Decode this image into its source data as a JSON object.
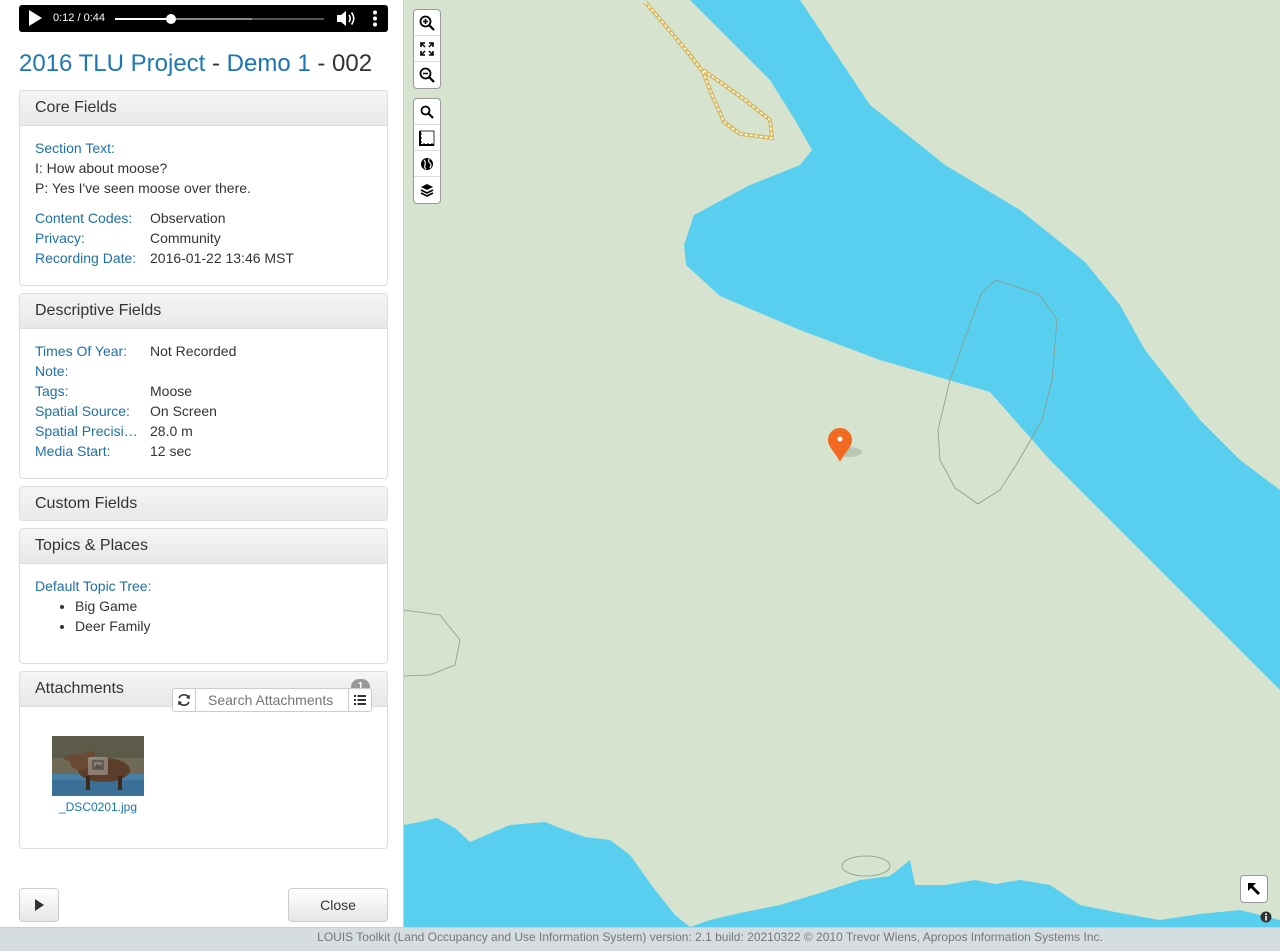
{
  "audio": {
    "time": "0:12 / 0:44",
    "progress": 0.27
  },
  "title": {
    "project": "2016 TLU Project",
    "sep1": " - ",
    "demo": "Demo 1",
    "sep2": " - ",
    "item": "002"
  },
  "core": {
    "heading": "Core Fields",
    "section_label": "Section Text:",
    "section_lines": [
      "I: How about moose?",
      "P: Yes I've seen moose over there."
    ],
    "rows": [
      {
        "label": "Content Codes:",
        "value": "Observation"
      },
      {
        "label": "Privacy:",
        "value": "Community"
      },
      {
        "label": "Recording Date:",
        "value": "2016-01-22 13:46 MST"
      }
    ]
  },
  "descriptive": {
    "heading": "Descriptive Fields",
    "rows": [
      {
        "label": "Times Of Year:",
        "value": "Not Recorded"
      },
      {
        "label": "Note:",
        "value": ""
      },
      {
        "label": "Tags:",
        "value": "Moose"
      },
      {
        "label": "Spatial Source:",
        "value": "On Screen"
      },
      {
        "label": "Spatial Precisi…",
        "value": "28.0 m"
      },
      {
        "label": "Media Start:",
        "value": "12 sec"
      }
    ]
  },
  "custom": {
    "heading": "Custom Fields"
  },
  "topics": {
    "heading": "Topics & Places",
    "tree_label": "Default Topic Tree:",
    "items": [
      "Big Game",
      "Deer Family"
    ]
  },
  "attachments": {
    "heading": "Attachments",
    "count": "1",
    "search_placeholder": "Search Attachments",
    "files": [
      "_DSC0201.jpg"
    ]
  },
  "buttons": {
    "close": "Close"
  },
  "footer": "LOUIS Toolkit (Land Occupancy and Use Information System) version: 2.1 build: 20210322 © 2010 Trevor Wiens, Apropos Information Systems Inc.",
  "colors": {
    "water": "#58cfee",
    "land": "#d5e3cf",
    "marker": "#f26a21",
    "link": "#1f6fa8"
  }
}
